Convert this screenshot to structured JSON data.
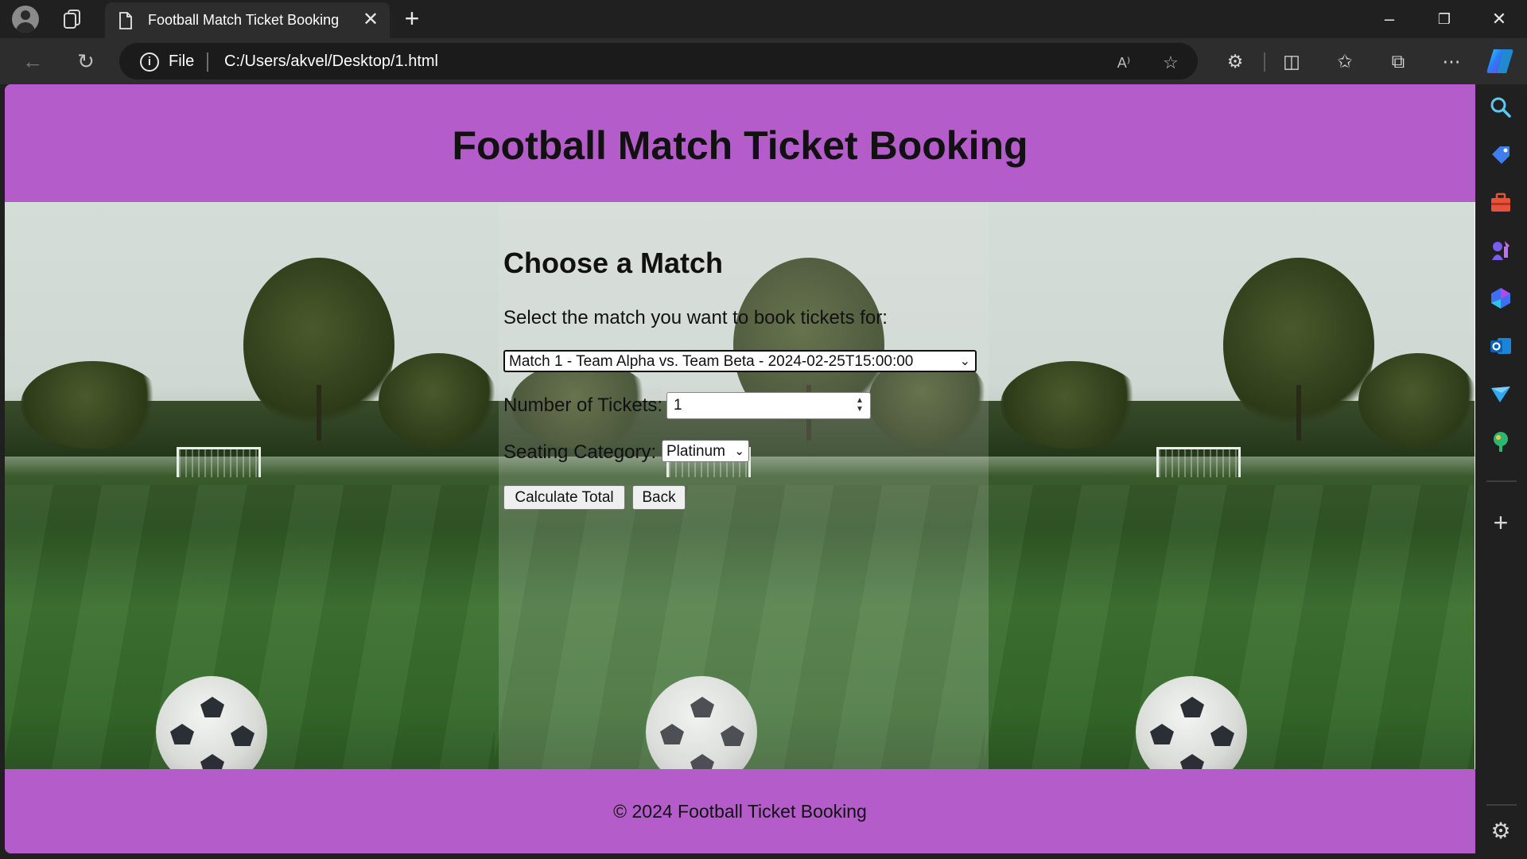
{
  "browser": {
    "tab_title": "Football Match Ticket Booking",
    "tab_close": "✕",
    "new_tab": "+",
    "address_scheme": "File",
    "address_url": "C:/Users/akvel/Desktop/1.html",
    "window_controls": [
      "–",
      "❐",
      "✕"
    ],
    "icons": [
      "back-icon",
      "refresh-icon",
      "info-icon",
      "read-aloud-icon",
      "favorite-icon",
      "extensions-icon",
      "split-screen-icon",
      "favorites-icon",
      "collections-icon",
      "more-icon",
      "copilot-icon"
    ]
  },
  "sidebar": {
    "icons": [
      "search-icon",
      "shopping-icon",
      "tools-icon",
      "games-icon",
      "microsoft365-icon",
      "outlook-icon",
      "drop-icon",
      "designer-icon",
      "add-icon",
      "settings-icon"
    ]
  },
  "page": {
    "header_title": "Football Match Ticket Booking",
    "section_title": "Choose a Match",
    "prompt": "Select the match you want to book tickets for:",
    "match_select": {
      "selected": "Match 1 - Team Alpha vs. Team Beta - 2024-02-25T15:00:00"
    },
    "tickets_label": "Number of Tickets:",
    "tickets_value": "1",
    "seating_label": "Seating Category:",
    "seating_select": {
      "selected": "Platinum"
    },
    "calculate_button": "Calculate Total",
    "back_button": "Back",
    "footer_text": "© 2024 Football Ticket Booking"
  },
  "colors": {
    "header_footer": "#b55ccb",
    "chrome_dark": "#202020",
    "chrome_toolbar": "#2d2d2d"
  }
}
